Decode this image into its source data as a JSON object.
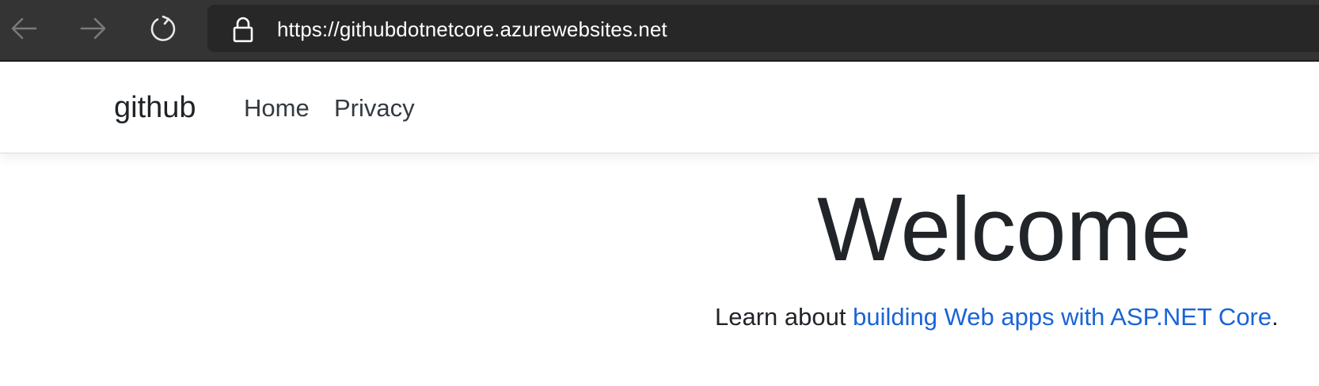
{
  "browser": {
    "url_scheme": "https://",
    "url_host": "githubdotnetcore.azurewebsites.net",
    "icons": {
      "back": "back-arrow-icon",
      "forward": "forward-arrow-icon",
      "reload": "reload-icon",
      "lock": "lock-icon"
    }
  },
  "navbar": {
    "brand": "github",
    "links": [
      {
        "label": "Home"
      },
      {
        "label": "Privacy"
      }
    ]
  },
  "main": {
    "title": "Welcome",
    "learn_prefix": "Learn about ",
    "learn_link": "building Web apps with ASP.NET Core",
    "learn_suffix": "."
  },
  "colors": {
    "browser_chrome": "#343434",
    "address_bar": "#272727",
    "link": "#1a64d6",
    "text": "#212529"
  }
}
